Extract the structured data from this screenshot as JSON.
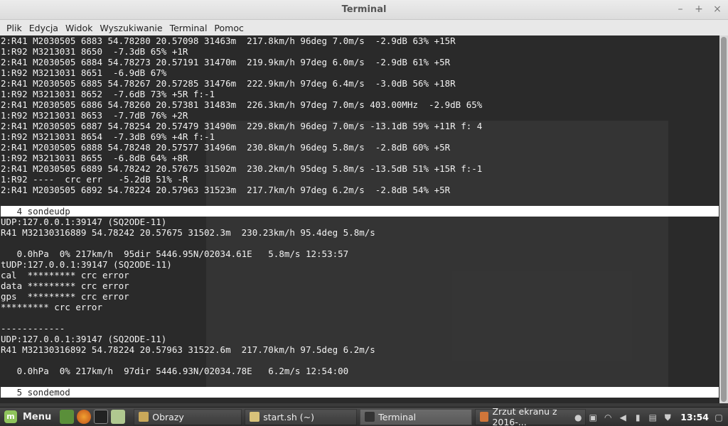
{
  "window": {
    "title": "Terminal"
  },
  "menu": [
    "Plik",
    "Edycja",
    "Widok",
    "Wyszukiwanie",
    "Terminal",
    "Pomoc"
  ],
  "terminal_lines": [
    {
      "text": "2:R41 M2030505 6883 54.78280 20.57098 31463m  217.8km/h 96deg 7.0m/s  -2.9dB 63% +15R",
      "hl": false
    },
    {
      "text": "1:R92 M3213031 8650  -7.3dB 65% +1R",
      "hl": false
    },
    {
      "text": "2:R41 M2030505 6884 54.78273 20.57191 31470m  219.9km/h 97deg 6.0m/s  -2.9dB 61% +5R",
      "hl": false
    },
    {
      "text": "1:R92 M3213031 8651  -6.9dB 67%",
      "hl": false
    },
    {
      "text": "2:R41 M2030505 6885 54.78267 20.57285 31476m  222.9km/h 97deg 6.4m/s  -3.0dB 56% +18R",
      "hl": false
    },
    {
      "text": "1:R92 M3213031 8652  -7.6dB 73% +5R f:-1",
      "hl": false
    },
    {
      "text": "2:R41 M2030505 6886 54.78260 20.57381 31483m  226.3km/h 97deg 7.0m/s 403.00MHz  -2.9dB 65%",
      "hl": false
    },
    {
      "text": "1:R92 M3213031 8653  -7.7dB 76% +2R",
      "hl": false
    },
    {
      "text": "2:R41 M2030505 6887 54.78254 20.57479 31490m  229.8km/h 96deg 7.0m/s -13.1dB 59% +11R f: 4",
      "hl": false
    },
    {
      "text": "1:R92 M3213031 8654  -7.3dB 69% +4R f:-1",
      "hl": false
    },
    {
      "text": "2:R41 M2030505 6888 54.78248 20.57577 31496m  230.8km/h 96deg 5.8m/s  -2.8dB 60% +5R",
      "hl": false
    },
    {
      "text": "1:R92 M3213031 8655  -6.8dB 64% +8R",
      "hl": false
    },
    {
      "text": "2:R41 M2030505 6889 54.78242 20.57675 31502m  230.2km/h 95deg 5.8m/s -13.5dB 51% +15R f:-1",
      "hl": false
    },
    {
      "text": "1:R92 ----  crc err   -5.2dB 51% -R",
      "hl": false
    },
    {
      "text": "2:R41 M2030505 6892 54.78224 20.57963 31523m  217.7km/h 97deg 6.2m/s  -2.8dB 54% +5R",
      "hl": false
    },
    {
      "text": "",
      "hl": false
    },
    {
      "text": "   4 sondeudp",
      "hl": true
    },
    {
      "text": "UDP:127.0.0.1:39147 (SQ2ODE-11)",
      "hl": false
    },
    {
      "text": "R41 M32130316889 54.78242 20.57675 31502.3m  230.23km/h 95.4deg 5.8m/s",
      "hl": false
    },
    {
      "text": "",
      "hl": false
    },
    {
      "text": "   0.0hPa  0% 217km/h  95dir 5446.95N/02034.61E   5.8m/s 12:53:57",
      "hl": false
    },
    {
      "text": "tUDP:127.0.0.1:39147 (SQ2ODE-11)",
      "hl": false
    },
    {
      "text": "cal  ********* crc error",
      "hl": false
    },
    {
      "text": "data ********* crc error",
      "hl": false
    },
    {
      "text": "gps  ********* crc error",
      "hl": false
    },
    {
      "text": "********* crc error",
      "hl": false
    },
    {
      "text": "",
      "hl": false
    },
    {
      "text": "------------",
      "hl": false
    },
    {
      "text": "UDP:127.0.0.1:39147 (SQ2ODE-11)",
      "hl": false
    },
    {
      "text": "R41 M32130316892 54.78224 20.57963 31522.6m  217.70km/h 97.5deg 6.2m/s",
      "hl": false
    },
    {
      "text": "",
      "hl": false
    },
    {
      "text": "   0.0hPa  0% 217km/h  97dir 5446.93N/02034.78E   6.2m/s 12:54:00",
      "hl": false
    },
    {
      "text": "",
      "hl": false
    },
    {
      "text": "   5 sondemod",
      "hl": true
    }
  ],
  "taskbar": {
    "menu_label": "Menu",
    "tasks": [
      {
        "label": "Obrazy",
        "icon": "folder-icon",
        "color": "#c9a85a",
        "active": false
      },
      {
        "label": "start.sh (~)",
        "icon": "text-editor-icon",
        "color": "#d9c27a",
        "active": false
      },
      {
        "label": "Terminal",
        "icon": "terminal-icon",
        "color": "#333333",
        "active": true
      },
      {
        "label": "Zrzut ekranu z 2016-...",
        "icon": "image-viewer-icon",
        "color": "#d0763a",
        "active": false
      }
    ],
    "clock": "13:54"
  }
}
